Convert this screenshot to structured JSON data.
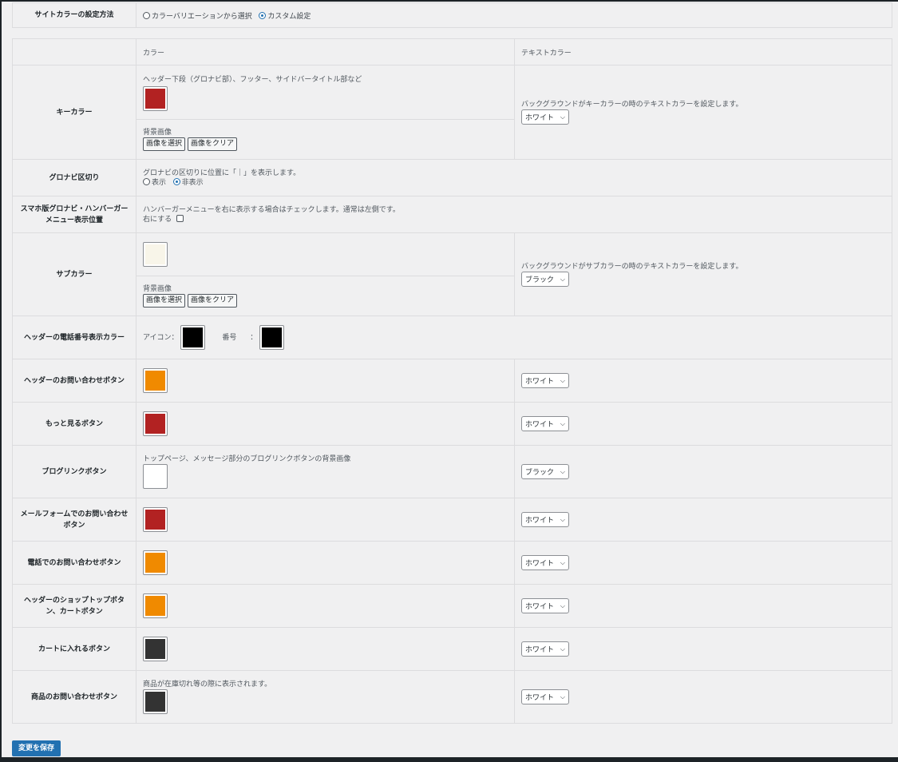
{
  "method": {
    "label": "サイトカラーの設定方法",
    "option_variation": "カラーバリエーションから選択",
    "option_custom": "カスタム設定"
  },
  "header": {
    "color": "カラー",
    "text_color": "テキストカラー"
  },
  "key_color": {
    "label": "キーカラー",
    "desc": "ヘッダー下段（グロナビ部）、フッター、サイドバータイトル部など",
    "swatch": "#b22222",
    "bg_label": "背景画像",
    "btn_select": "画像を選択",
    "btn_clear": "画像をクリア",
    "text_desc": "バックグラウンドがキーカラーの時のテキストカラーを設定します。",
    "text_value": "ホワイト"
  },
  "gnavi_divider": {
    "label": "グロナビ区切り",
    "desc": "グロナビの区切りに位置に「｜」を表示します。",
    "opt_show": "表示",
    "opt_hide": "非表示"
  },
  "hamburger": {
    "label": "スマホ版グロナビ・ハンバーガーメニュー表示位置",
    "desc": "ハンバーガーメニューを右に表示する場合はチェックします。通常は左側です。",
    "checkbox_label": "右にする"
  },
  "sub_color": {
    "label": "サブカラー",
    "swatch": "#f8f5e9",
    "bg_label": "背景画像",
    "btn_select": "画像を選択",
    "btn_clear": "画像をクリア",
    "text_desc": "バックグラウンドがサブカラーの時のテキストカラーを設定します。",
    "text_value": "ブラック"
  },
  "phone_color": {
    "label": "ヘッダーの電話番号表示カラー",
    "icon_label": "アイコン：",
    "icon_swatch": "#000000",
    "number_label": "番号",
    "number_colon": "：",
    "number_swatch": "#000000"
  },
  "rows": [
    {
      "label": "ヘッダーのお問い合わせボタン",
      "desc": "",
      "swatch": "#f08a00",
      "text_value": "ホワイト"
    },
    {
      "label": "もっと見るボタン",
      "desc": "",
      "swatch": "#b22222",
      "text_value": "ホワイト"
    },
    {
      "label": "ブログリンクボタン",
      "desc": "トップページ、メッセージ部分のブログリンクボタンの背景画像",
      "swatch": "#ffffff",
      "text_value": "ブラック"
    },
    {
      "label": "メールフォームでのお問い合わせボタン",
      "desc": "",
      "swatch": "#b22222",
      "text_value": "ホワイト"
    },
    {
      "label": "電話でのお問い合わせボタン",
      "desc": "",
      "swatch": "#f08a00",
      "text_value": "ホワイト"
    },
    {
      "label": "ヘッダーのショップトップボタン、カートボタン",
      "desc": "",
      "swatch": "#f08a00",
      "text_value": "ホワイト"
    },
    {
      "label": "カートに入れるボタン",
      "desc": "",
      "swatch": "#333333",
      "text_value": "ホワイト"
    },
    {
      "label": "商品のお問い合わせボタン",
      "desc": "商品が在庫切れ等の際に表示されます。",
      "swatch": "#333333",
      "text_value": "ホワイト"
    }
  ],
  "save_label": "変更を保存"
}
